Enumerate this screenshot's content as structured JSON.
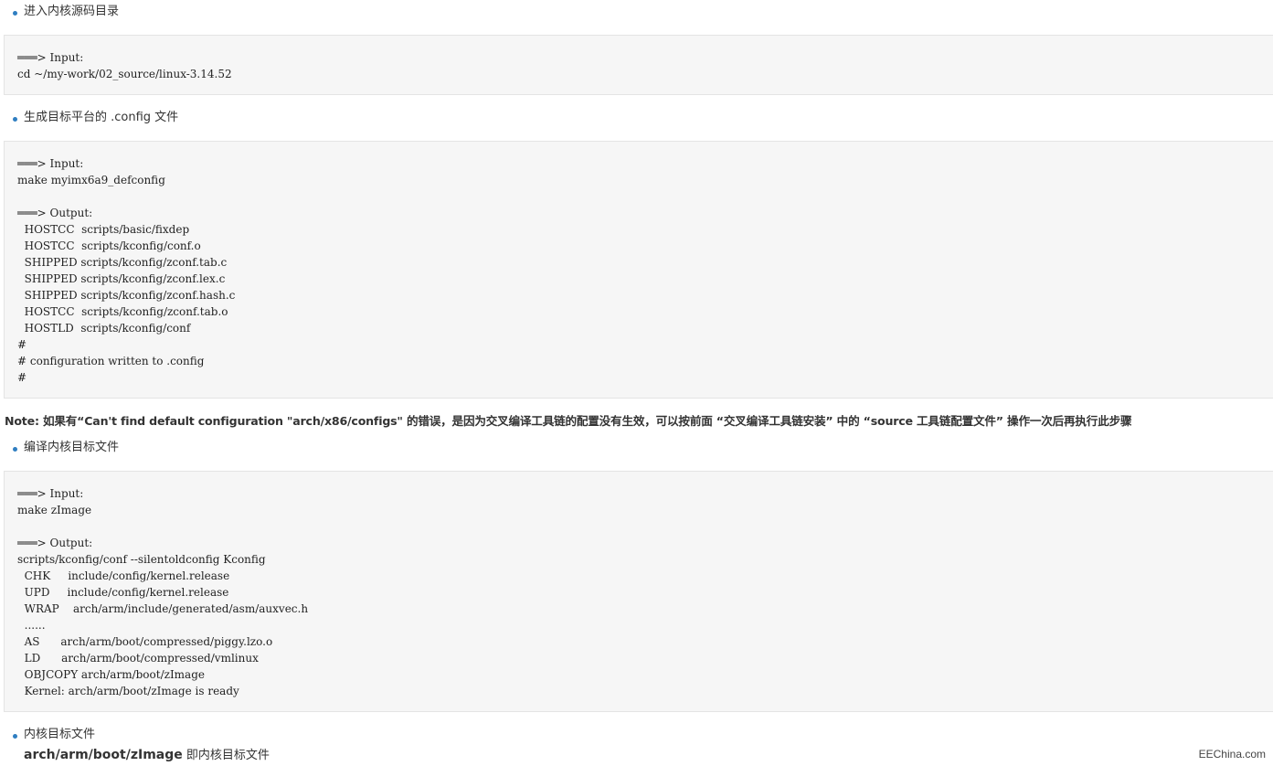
{
  "bullets": {
    "b1": "进入内核源码目录",
    "b2": "生成目标平台的 .config 文件",
    "b3": "编译内核目标文件",
    "b4": "内核目标文件"
  },
  "code_blocks": {
    "c1": "═══> Input:\ncd ~/my-work/02_source/linux-3.14.52",
    "c2": "═══> Input:\nmake myimx6a9_defconfig\n\n═══> Output:\n  HOSTCC  scripts/basic/fixdep\n  HOSTCC  scripts/kconfig/conf.o\n  SHIPPED scripts/kconfig/zconf.tab.c\n  SHIPPED scripts/kconfig/zconf.lex.c\n  SHIPPED scripts/kconfig/zconf.hash.c\n  HOSTCC  scripts/kconfig/zconf.tab.o\n  HOSTLD  scripts/kconfig/conf\n#\n# configuration written to .config\n#",
    "c3": "═══> Input:\nmake zImage\n\n═══> Output:\nscripts/kconfig/conf --silentoldconfig Kconfig\n  CHK     include/config/kernel.release\n  UPD     include/config/kernel.release\n  WRAP    arch/arm/include/generated/asm/auxvec.h\n  ......\n  AS      arch/arm/boot/compressed/piggy.lzo.o\n  LD      arch/arm/boot/compressed/vmlinux\n  OBJCOPY arch/arm/boot/zImage\n  Kernel: arch/arm/boot/zImage is ready"
  },
  "note": "Note: 如果有“Can't find default configuration \"arch/x86/configs\" 的错误，是因为交叉编译工具链的配置没有生效，可以按前面 “交叉编译工具链安装” 中的 “source 工具链配置文件” 操作一次后再执行此步骤",
  "final_line": {
    "path": "arch/arm/boot/zImage",
    "text": " 即内核目标文件"
  },
  "watermark": "EEChina.com",
  "colors": {
    "bullet_dot": "#2f7ec1",
    "code_bg": "#f6f6f6",
    "code_border": "#e4e4e4"
  }
}
